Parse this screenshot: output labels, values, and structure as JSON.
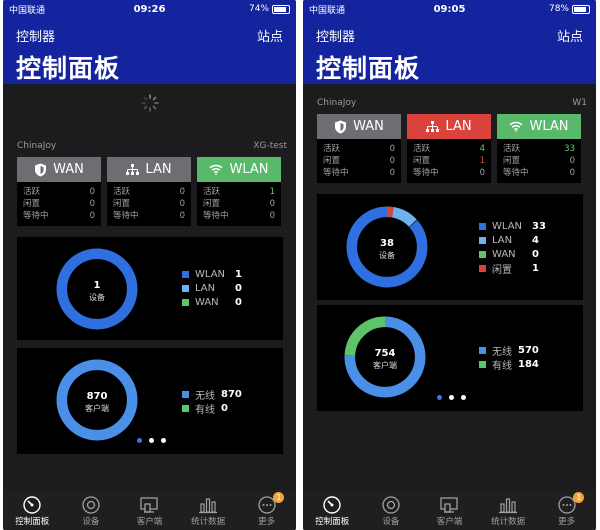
{
  "left": {
    "status": {
      "carrier": "中国联通",
      "time": "09:26",
      "battery": "74%",
      "battery_level": 0.74
    },
    "nav": {
      "back": "控制器",
      "site": "站点",
      "title": "控制面板"
    },
    "device": {
      "name": "ChinaJoy",
      "model": "XG-test"
    },
    "cards": [
      {
        "label": "WAN",
        "icon": "shield-icon",
        "rows": [
          {
            "k": "活跃",
            "v": "0"
          },
          {
            "k": "闲置",
            "v": "0"
          },
          {
            "k": "等待中",
            "v": "0"
          }
        ]
      },
      {
        "label": "LAN",
        "icon": "network-icon",
        "rows": [
          {
            "k": "活跃",
            "v": "0"
          },
          {
            "k": "闲置",
            "v": "0"
          },
          {
            "k": "等待中",
            "v": "0"
          }
        ]
      },
      {
        "label": "WLAN",
        "icon": "wifi-icon",
        "rows": [
          {
            "k": "活跃",
            "v": "1"
          },
          {
            "k": "闲置",
            "v": "0"
          },
          {
            "k": "等待中",
            "v": "0"
          }
        ]
      }
    ],
    "devices_donut": {
      "total": "1",
      "label": "设备",
      "legend": [
        {
          "name": "WLAN",
          "value": "1",
          "color": "#2f6fe0"
        },
        {
          "name": "LAN",
          "value": "0",
          "color": "#6fb0f0"
        },
        {
          "name": "WAN",
          "value": "0",
          "color": "#5ec46a"
        }
      ]
    },
    "clients_donut": {
      "total": "870",
      "label": "客户端",
      "legend": [
        {
          "name": "无线",
          "value": "870",
          "color": "#4a90e8"
        },
        {
          "name": "有线",
          "value": "0",
          "color": "#5ec46a"
        }
      ]
    }
  },
  "right": {
    "status": {
      "carrier": "中国联通",
      "time": "09:05",
      "battery": "78%",
      "battery_level": 0.78
    },
    "nav": {
      "back": "控制器",
      "site": "站点",
      "title": "控制面板"
    },
    "device": {
      "name": "ChinaJoy",
      "model": "W1"
    },
    "cards": [
      {
        "label": "WAN",
        "icon": "shield-icon",
        "rows": [
          {
            "k": "活跃",
            "v": "0"
          },
          {
            "k": "闲置",
            "v": "0"
          },
          {
            "k": "等待中",
            "v": "0"
          }
        ]
      },
      {
        "label": "LAN",
        "icon": "network-icon",
        "rows": [
          {
            "k": "活跃",
            "v": "4"
          },
          {
            "k": "闲置",
            "v": "1"
          },
          {
            "k": "等待中",
            "v": "0"
          }
        ]
      },
      {
        "label": "WLAN",
        "icon": "wifi-icon",
        "rows": [
          {
            "k": "活跃",
            "v": "33"
          },
          {
            "k": "闲置",
            "v": "0"
          },
          {
            "k": "等待中",
            "v": "0"
          }
        ]
      }
    ],
    "devices_donut": {
      "total": "38",
      "label": "设备",
      "legend": [
        {
          "name": "WLAN",
          "value": "33",
          "color": "#2f6fe0"
        },
        {
          "name": "LAN",
          "value": "4",
          "color": "#6fb0f0"
        },
        {
          "name": "WAN",
          "value": "0",
          "color": "#5ec46a"
        },
        {
          "name": "闲置",
          "value": "1",
          "color": "#d9433b"
        }
      ]
    },
    "clients_donut": {
      "total": "754",
      "label": "客户端",
      "legend": [
        {
          "name": "无线",
          "value": "570",
          "color": "#4a90e8"
        },
        {
          "name": "有线",
          "value": "184",
          "color": "#5ec46a"
        }
      ]
    }
  },
  "tabs": [
    {
      "label": "控制面板",
      "icon": "dashboard-icon"
    },
    {
      "label": "设备",
      "icon": "device-icon"
    },
    {
      "label": "客户端",
      "icon": "clients-icon"
    },
    {
      "label": "统计数据",
      "icon": "stats-icon"
    },
    {
      "label": "更多",
      "icon": "more-icon",
      "badge": "1"
    }
  ]
}
